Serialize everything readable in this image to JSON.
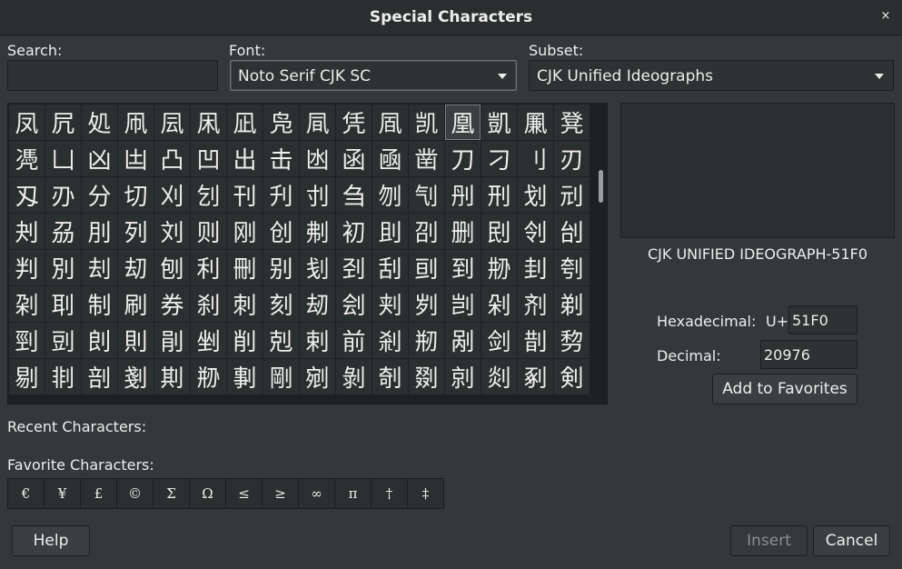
{
  "window": {
    "title": "Special Characters",
    "close_glyph": "×"
  },
  "search": {
    "label": "Search:",
    "value": ""
  },
  "font": {
    "label": "Font:",
    "value": "Noto Serif CJK SC"
  },
  "subset": {
    "label": "Subset:",
    "value": "CJK Unified Ideographs"
  },
  "grid": {
    "selected_index": 12,
    "chars": [
      "凤",
      "凥",
      "処",
      "凧",
      "凨",
      "凩",
      "凪",
      "凫",
      "凬",
      "凭",
      "凮",
      "凯",
      "凰",
      "凱",
      "凲",
      "凳",
      "凴",
      "凵",
      "凶",
      "凷",
      "凸",
      "凹",
      "出",
      "击",
      "凼",
      "函",
      "凾",
      "凿",
      "刀",
      "刁",
      "刂",
      "刃",
      "刄",
      "刅",
      "分",
      "切",
      "刈",
      "刉",
      "刊",
      "刋",
      "刌",
      "刍",
      "刎",
      "刏",
      "刐",
      "刑",
      "划",
      "刓",
      "刔",
      "刕",
      "刖",
      "列",
      "刘",
      "则",
      "刚",
      "创",
      "刜",
      "初",
      "刞",
      "刟",
      "删",
      "刡",
      "刢",
      "刣",
      "判",
      "別",
      "刦",
      "刧",
      "刨",
      "利",
      "刪",
      "别",
      "刬",
      "刭",
      "刮",
      "刯",
      "到",
      "刱",
      "刲",
      "刳",
      "刴",
      "刵",
      "制",
      "刷",
      "券",
      "刹",
      "刺",
      "刻",
      "刼",
      "刽",
      "刾",
      "刿",
      "剀",
      "剁",
      "剂",
      "剃",
      "剄",
      "剅",
      "剆",
      "則",
      "剈",
      "剉",
      "削",
      "剋",
      "剌",
      "前",
      "剎",
      "剏",
      "剐",
      "剑",
      "剒",
      "剓",
      "剔",
      "剕",
      "剖",
      "剗",
      "剘",
      "剙",
      "剚",
      "剛",
      "剜",
      "剝",
      "剞",
      "剟",
      "剠",
      "剡",
      "剢",
      "剣"
    ]
  },
  "details": {
    "char_name": "CJK UNIFIED IDEOGRAPH-51F0",
    "hex_label": "Hexadecimal:",
    "hex_prefix": "U+",
    "hex_value": "51F0",
    "dec_label": "Decimal:",
    "dec_value": "20976",
    "add_favorites": "Add to Favorites"
  },
  "recent": {
    "label": "Recent Characters:"
  },
  "favorites": {
    "label": "Favorite Characters:",
    "chars": [
      "€",
      "¥",
      "£",
      "©",
      "Σ",
      "Ω",
      "≤",
      "≥",
      "∞",
      "π",
      "†",
      "‡"
    ]
  },
  "buttons": {
    "help": "Help",
    "insert": "Insert",
    "cancel": "Cancel"
  }
}
